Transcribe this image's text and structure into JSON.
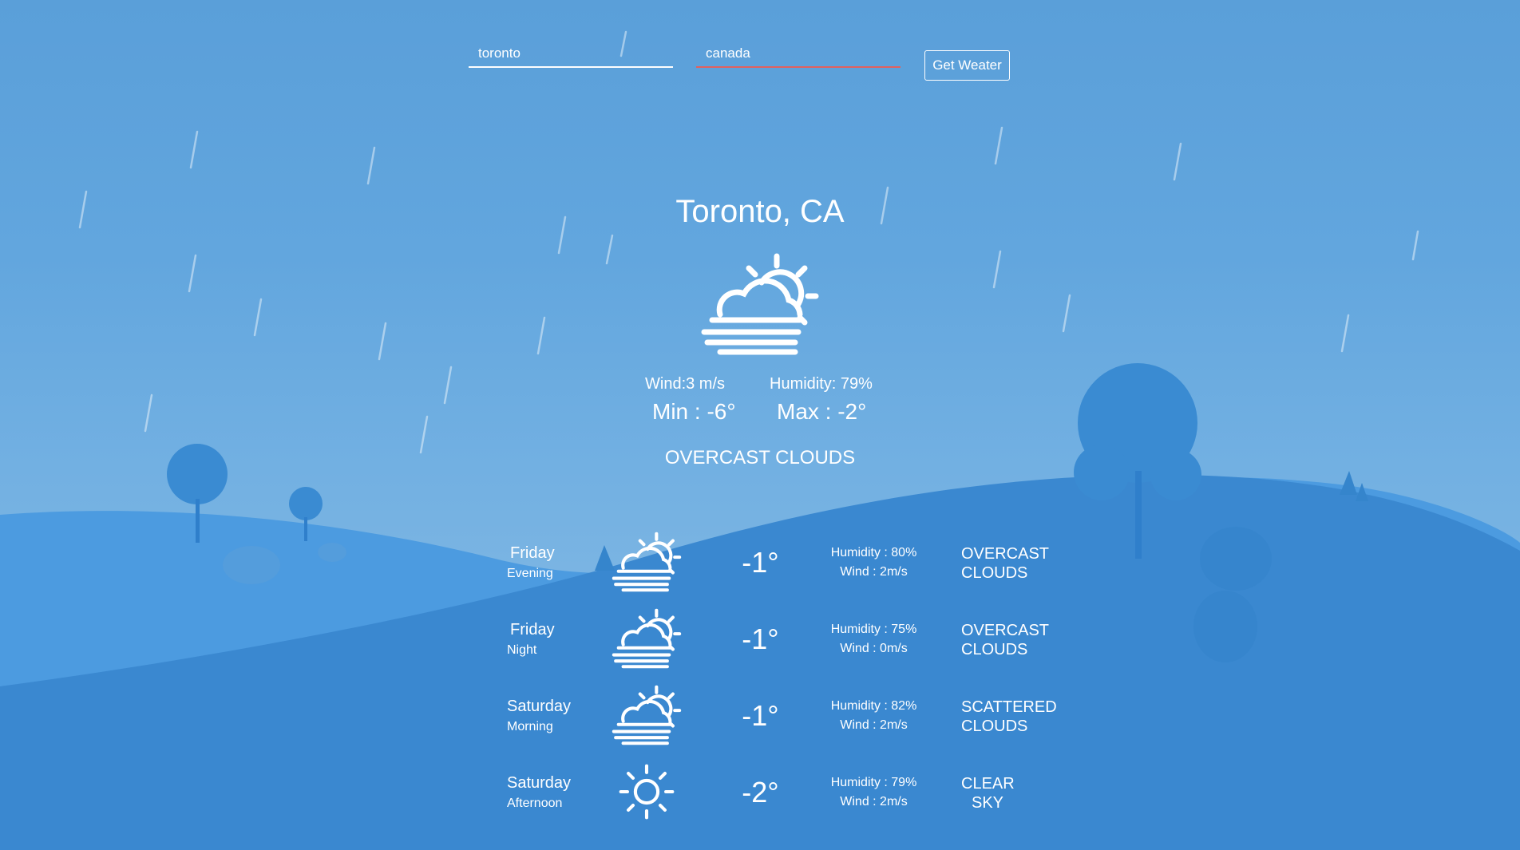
{
  "search": {
    "city_value": "toronto",
    "country_value": "canada",
    "button_label": "Get Weater"
  },
  "current": {
    "location": "Toronto, CA",
    "icon": "cloud-sun-fog-icon",
    "wind": "Wind:3 m/s",
    "humidity": "Humidity: 79%",
    "min": "Min : -6°",
    "max": "Max : -2°",
    "condition": "OVERCAST CLOUDS"
  },
  "forecast": [
    {
      "day": "Friday",
      "period": "Evening",
      "icon": "cloud-sun-fog-icon",
      "temp": "-1°",
      "humidity": "Humidity : 80%",
      "wind": "Wind : 2m/s",
      "condition_line1": "OVERCAST",
      "condition_line2": "CLOUDS"
    },
    {
      "day": "Friday",
      "period": "Night",
      "icon": "cloud-sun-fog-icon",
      "temp": "-1°",
      "humidity": "Humidity : 75%",
      "wind": "Wind : 0m/s",
      "condition_line1": "OVERCAST",
      "condition_line2": "CLOUDS"
    },
    {
      "day": "Saturday",
      "period": "Morning",
      "icon": "cloud-sun-fog-icon",
      "temp": "-1°",
      "humidity": "Humidity : 82%",
      "wind": "Wind : 2m/s",
      "condition_line1": "SCATTERED",
      "condition_line2": "CLOUDS"
    },
    {
      "day": "Saturday",
      "period": "Afternoon",
      "icon": "sun-icon",
      "temp": "-2°",
      "humidity": "Humidity : 79%",
      "wind": "Wind : 2m/s",
      "condition_line1": "CLEAR",
      "condition_line2": "SKY"
    }
  ],
  "colors": {
    "sky": "#5a9fd9",
    "hill_back": "#4f9ee0",
    "hill_front": "#3a88d0",
    "tree": "#3a8bd2",
    "country_underline": "#e2605e"
  }
}
